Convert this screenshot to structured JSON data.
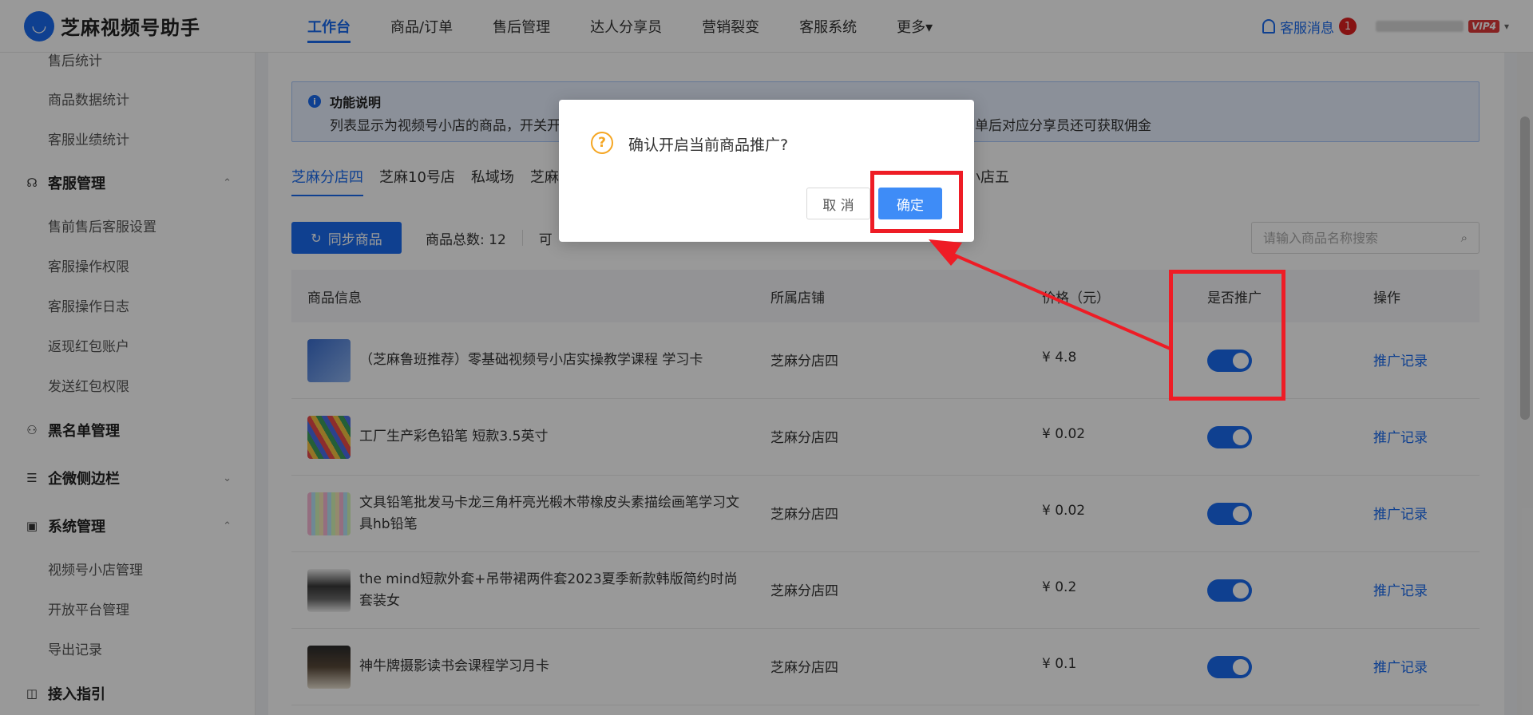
{
  "app": {
    "logo_mark": "◡",
    "title": "芝麻视频号助手"
  },
  "nav": {
    "items": [
      "工作台",
      "商品/订单",
      "售后管理",
      "达人分享员",
      "营销裂变",
      "客服系统",
      "更多▾"
    ],
    "messages_label": "客服消息",
    "message_count": "1",
    "vip_label": "VIP4",
    "caret": "▾"
  },
  "sidebar": {
    "top_items": [
      "售后统计",
      "商品数据统计",
      "客服业绩统计"
    ],
    "kefu_group": "客服管理",
    "kefu_items": [
      "售前售后客服设置",
      "客服操作权限",
      "客服操作日志",
      "返现红包账户",
      "发送红包权限"
    ],
    "blacklist_group": "黑名单管理",
    "wecom_group": "企微侧边栏",
    "system_group": "系统管理",
    "system_items": [
      "视频号小店管理",
      "开放平台管理",
      "导出记录"
    ],
    "guide_group": "接入指引",
    "chev_up": "⌃",
    "chev_down": "⌄"
  },
  "notice": {
    "title": "功能说明",
    "text_left": "列表显示为视频号小店的商品，开关开",
    "text_right": "锁客，且买家下单后对应分享员还可获取佣金"
  },
  "shop_tabs": [
    "芝麻分店四",
    "芝麻10号店",
    "私域场",
    "芝麻的"
  ],
  "shop_tab_tail": "小店五",
  "toolbar": {
    "sync_label": "同步商品",
    "sync_icon": "↻",
    "total_label": "商品总数:",
    "total_value": "12",
    "stat2": "可"
  },
  "search": {
    "placeholder": "请输入商品名称搜索",
    "icon": "🔍"
  },
  "table": {
    "headers": [
      "商品信息",
      "所属店铺",
      "价格（元）",
      "是否推广",
      "操作"
    ],
    "rows": [
      {
        "name": "（芝麻鲁班推荐）零基础视频号小店实操教学课程 学习卡",
        "shop": "芝麻分店四",
        "price": "¥ 4.8",
        "action": "推广记录"
      },
      {
        "name": "工厂生产彩色铅笔 短款3.5英寸",
        "shop": "芝麻分店四",
        "price": "¥ 0.02",
        "action": "推广记录"
      },
      {
        "name": "文具铅笔批发马卡龙三角杆亮光椴木带橡皮头素描绘画笔学习文具hb铅笔",
        "shop": "芝麻分店四",
        "price": "¥ 0.02",
        "action": "推广记录"
      },
      {
        "name": "the mind短款外套+吊带裙两件套2023夏季新款韩版简约时尚套装女",
        "shop": "芝麻分店四",
        "price": "¥ 0.2",
        "action": "推广记录"
      },
      {
        "name": "神牛牌摄影读书会课程学习月卡",
        "shop": "芝麻分店四",
        "price": "¥ 0.1",
        "action": "推广记录"
      }
    ]
  },
  "dialog": {
    "icon": "?",
    "message": "确认开启当前商品推广?",
    "cancel": "取 消",
    "confirm": "确定"
  },
  "colors": {
    "primary": "#1a6cf0",
    "annotation": "#ee1c25",
    "warning": "#f5a623"
  }
}
